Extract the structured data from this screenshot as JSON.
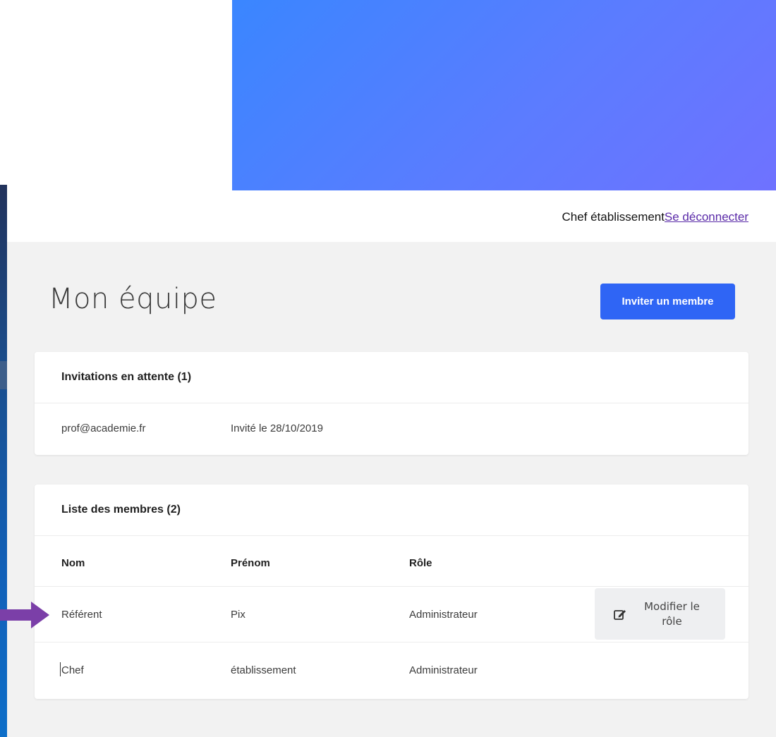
{
  "header": {
    "user_name": "Chef établissement",
    "logout_label": "Se déconnecter"
  },
  "page": {
    "title": "Mon équipe",
    "invite_button_label": "Inviter un membre"
  },
  "invitations": {
    "title": "Invitations en attente (1)",
    "rows": [
      {
        "email": "prof@academie.fr",
        "date": "Invité le 28/10/2019"
      }
    ]
  },
  "members": {
    "title": "Liste des membres (2)",
    "columns": [
      "Nom",
      "Prénom",
      "Rôle"
    ],
    "rows": [
      {
        "nom": "Référent",
        "prenom": "Pix",
        "role": "Administrateur",
        "action_label": "Modifier le rôle"
      },
      {
        "nom": "Chef",
        "prenom": "établissement",
        "role": "Administrateur"
      }
    ]
  },
  "icons": {
    "edit": "edit-icon",
    "arrow": "arrow-right-icon"
  },
  "colors": {
    "banner_start": "#3a86ff",
    "banner_end": "#6f72ff",
    "primary_button": "#2f65f5",
    "link": "#5a2aa8",
    "annotation_arrow": "#7b3fa8",
    "page_background": "#f2f2f2"
  }
}
